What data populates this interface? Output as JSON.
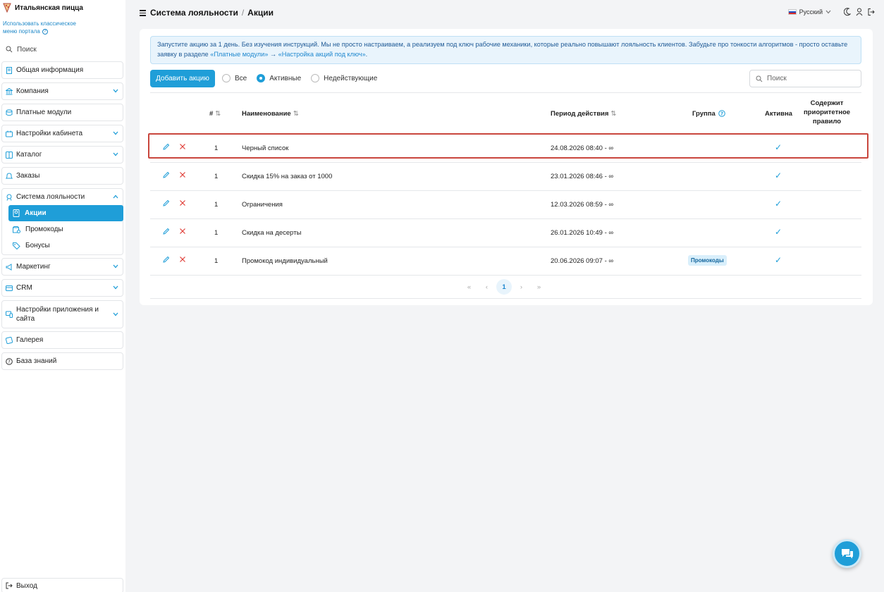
{
  "sidebar": {
    "brand": "Итальянская пицца",
    "classic_link": "Использовать классическое меню портала",
    "search_label": "Поиск",
    "items": {
      "general": "Общая информация",
      "company": "Компания",
      "paid": "Платные модули",
      "cabinet": "Настройки кабинета",
      "catalog": "Каталог",
      "orders": "Заказы",
      "loyalty": "Система лояльности",
      "actions": "Акции",
      "promocodes": "Промокоды",
      "bonuses": "Бонусы",
      "marketing": "Маркетинг",
      "crm": "CRM",
      "app_settings": "Настройки приложения и сайта",
      "gallery": "Галерея",
      "kb": "База знаний",
      "logout": "Выход"
    }
  },
  "header": {
    "crumb1": "Система лояльности",
    "sep": "/",
    "crumb2": "Акции",
    "language": "Русский"
  },
  "notice": {
    "text": "Запустите акцию за 1 день. Без изучения инструкций. Мы не просто настраиваем, а реализуем под ключ рабочие механики, которые реально повышают лояльность клиентов. Забудьте про тонкости алгоритмов - просто оставьте заявку в разделе ",
    "link1": "«Платные модули»",
    "arrow": " → ",
    "link2": "«Настройка акций под ключ»",
    "end": "."
  },
  "toolbar": {
    "add_label": "Добавить акцию",
    "filter_all": "Все",
    "filter_active": "Активные",
    "filter_inactive": "Недействующие",
    "search_placeholder": "Поиск"
  },
  "table": {
    "headers": {
      "num": "#",
      "name": "Наименование",
      "period": "Период действия",
      "group": "Группа",
      "active": "Активна",
      "priority": "Содержит приоритетное правило"
    },
    "rows": [
      {
        "num": "1",
        "name": "Черный список",
        "period": "24.08.2026 08:40 - ∞",
        "group": "",
        "active": "✓"
      },
      {
        "num": "1",
        "name": "Скидка 15% на заказ от 1000",
        "period": "23.01.2026 08:46 - ∞",
        "group": "",
        "active": "✓"
      },
      {
        "num": "1",
        "name": "Ограничения",
        "period": "12.03.2026 08:59 - ∞",
        "group": "",
        "active": "✓"
      },
      {
        "num": "1",
        "name": "Скидка на десерты",
        "period": "26.01.2026 10:49 - ∞",
        "group": "",
        "active": "✓"
      },
      {
        "num": "1",
        "name": "Промокод индивидуальный",
        "period": "20.06.2026 09:07 - ∞",
        "group": "Промокоды",
        "active": "✓"
      }
    ]
  },
  "pagination": {
    "first": "«",
    "prev": "‹",
    "current": "1",
    "next": "›",
    "last": "»"
  },
  "colors": {
    "accent": "#1f9ed8",
    "highlight": "#c9463d",
    "delete": "#e0413a"
  }
}
